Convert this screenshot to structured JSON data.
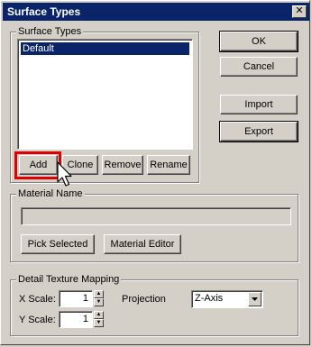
{
  "window": {
    "title": "Surface Types",
    "close_glyph": "✕"
  },
  "surface_types": {
    "group_label": "Surface Types",
    "items": [
      "Default"
    ],
    "selected": "Default",
    "buttons": {
      "add": "Add",
      "clone": "Clone",
      "remove": "Remove",
      "rename": "Rename"
    }
  },
  "dialog_buttons": {
    "ok": "OK",
    "cancel": "Cancel",
    "import": "Import",
    "export": "Export"
  },
  "material": {
    "group_label": "Material Name",
    "value": "",
    "pick_selected": "Pick Selected",
    "material_editor": "Material Editor"
  },
  "detail_mapping": {
    "group_label": "Detail Texture Mapping",
    "x_scale_label": "X Scale:",
    "x_scale_value": "1",
    "y_scale_label": "Y Scale:",
    "y_scale_value": "1",
    "projection_label": "Projection",
    "projection_value": "Z-Axis"
  },
  "highlight": {
    "color": "#e00000",
    "target": "add-button"
  },
  "colors": {
    "titlebar": "#0a246a",
    "face": "#d4d0c8",
    "selection": "#0a246a"
  }
}
